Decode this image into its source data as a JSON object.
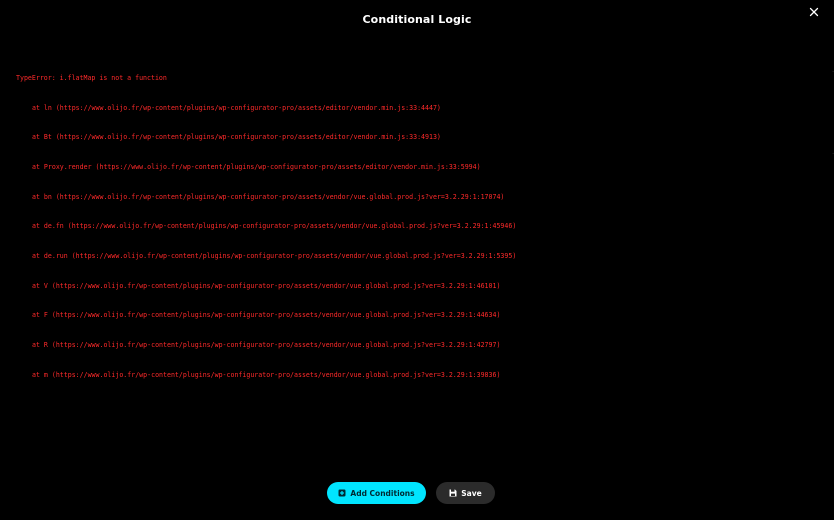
{
  "modal": {
    "title": "Conditional Logic"
  },
  "error": {
    "lines": [
      "TypeError: i.flatMap is not a function",
      "at ln (https://www.olijo.fr/wp-content/plugins/wp-configurator-pro/assets/editor/vendor.min.js:33:4447)",
      "at Bt (https://www.olijo.fr/wp-content/plugins/wp-configurator-pro/assets/editor/vendor.min.js:33:4913)",
      "at Proxy.render (https://www.olijo.fr/wp-content/plugins/wp-configurator-pro/assets/editor/vendor.min.js:33:5994)",
      "at bn (https://www.olijo.fr/wp-content/plugins/wp-configurator-pro/assets/vendor/vue.global.prod.js?ver=3.2.29:1:17074)",
      "at de.fn (https://www.olijo.fr/wp-content/plugins/wp-configurator-pro/assets/vendor/vue.global.prod.js?ver=3.2.29:1:45946)",
      "at de.run (https://www.olijo.fr/wp-content/plugins/wp-configurator-pro/assets/vendor/vue.global.prod.js?ver=3.2.29:1:5395)",
      "at V (https://www.olijo.fr/wp-content/plugins/wp-configurator-pro/assets/vendor/vue.global.prod.js?ver=3.2.29:1:46101)",
      "at F (https://www.olijo.fr/wp-content/plugins/wp-configurator-pro/assets/vendor/vue.global.prod.js?ver=3.2.29:1:44634)",
      "at R (https://www.olijo.fr/wp-content/plugins/wp-configurator-pro/assets/vendor/vue.global.prod.js?ver=3.2.29:1:42797)",
      "at m (https://www.olijo.fr/wp-content/plugins/wp-configurator-pro/assets/vendor/vue.global.prod.js?ver=3.2.29:1:39836)"
    ]
  },
  "footer": {
    "add_conditions_label": "Add Conditions",
    "save_label": "Save"
  },
  "icons": {
    "close": "close-icon",
    "add": "plus-square-icon",
    "save": "floppy-disk-icon"
  },
  "colors": {
    "background": "#000000",
    "error_text": "#ff2a2a",
    "accent": "#00e5ff",
    "save_button": "#2b2b2b",
    "title": "#ffffff"
  }
}
